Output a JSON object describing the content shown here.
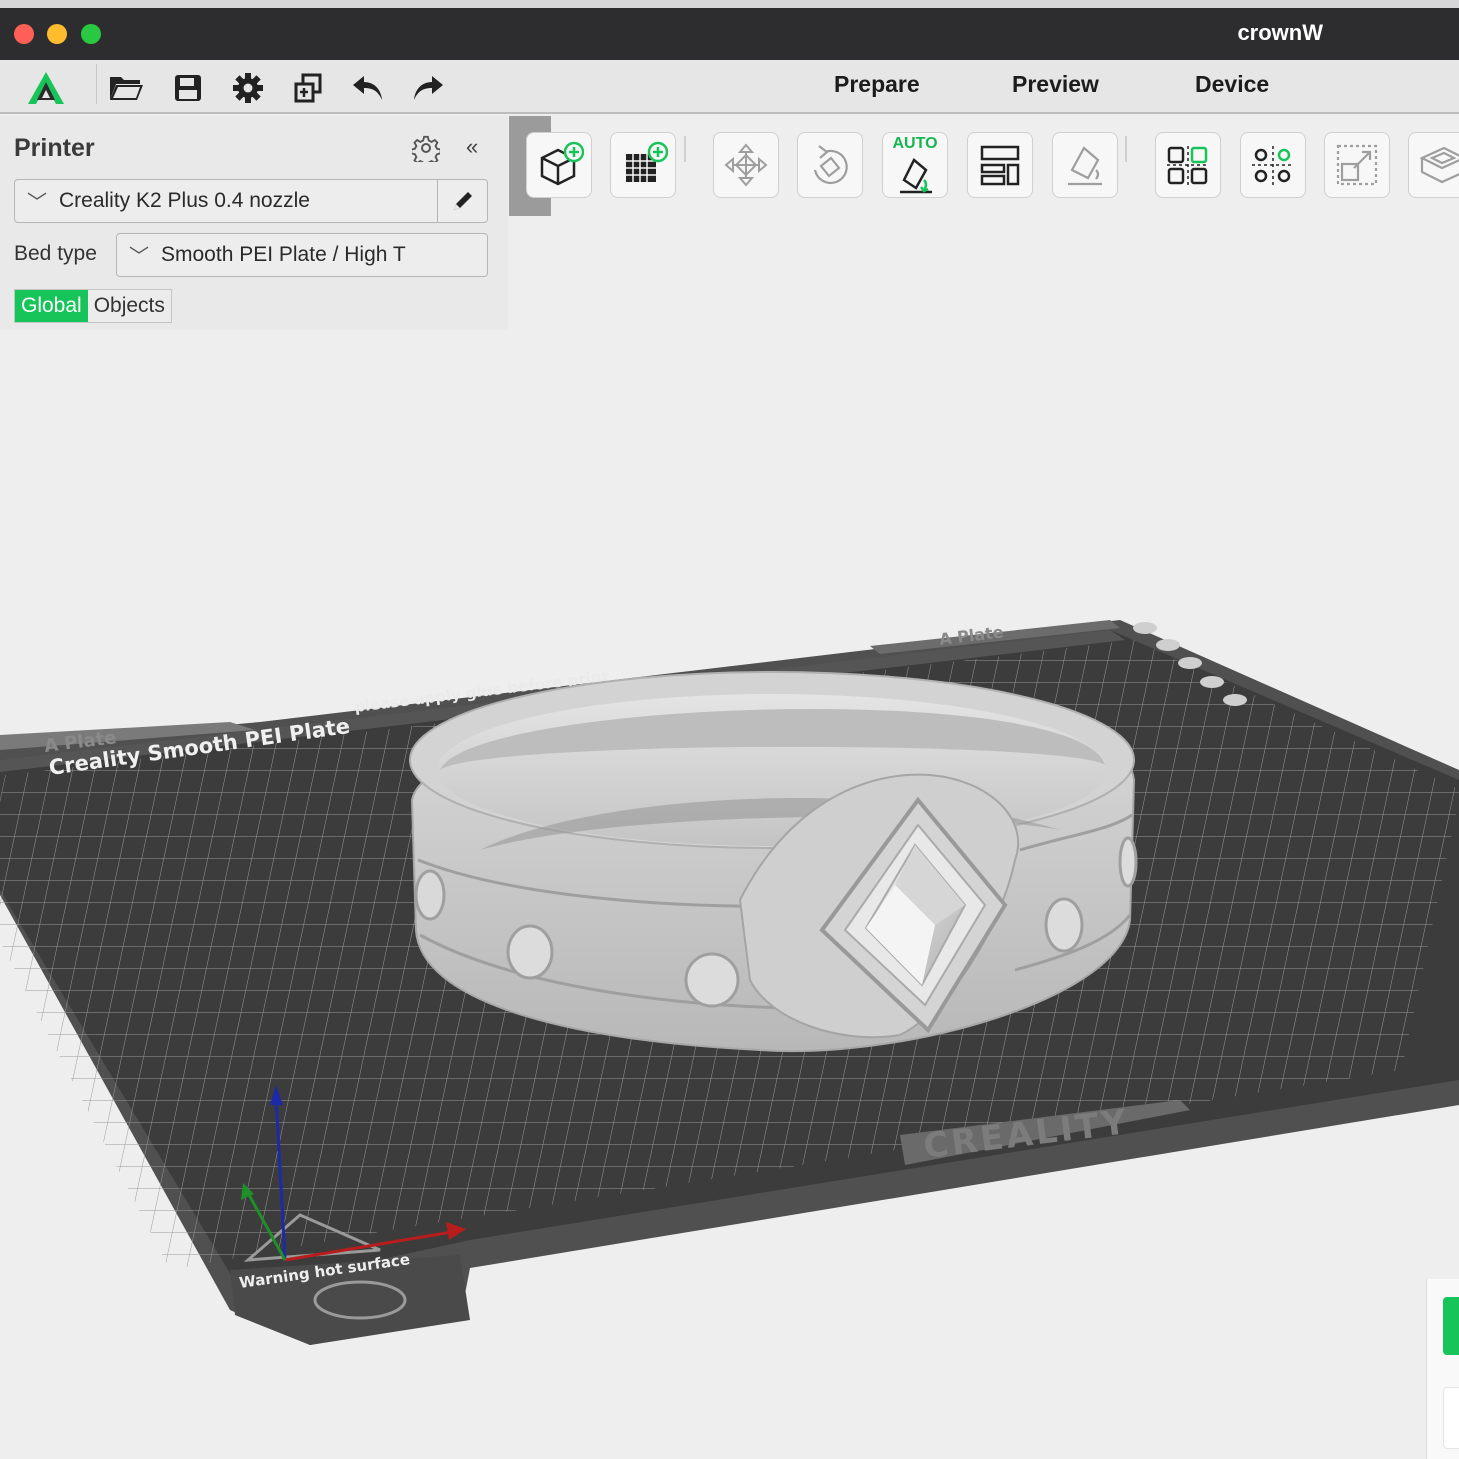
{
  "window": {
    "title": "crownW"
  },
  "toolbar": {
    "icons": [
      "app-logo-icon",
      "open-folder-icon",
      "save-icon",
      "settings-gear-icon",
      "copy-icon",
      "undo-icon",
      "redo-icon"
    ],
    "tabs": {
      "prepare": "Prepare",
      "preview": "Preview",
      "device": "Device"
    }
  },
  "panel": {
    "title": "Printer",
    "printer_value": "Creality K2 Plus 0.4 nozzle",
    "bed_type_label": "Bed type",
    "bed_type_value": "Smooth PEI Plate / High T",
    "collapse_glyph": "«",
    "chevron_glyph": "﹀",
    "segments": {
      "global": "Global",
      "objects": "Objects"
    }
  },
  "canvas_toolbar": {
    "handle_glyph": "‹",
    "auto_label": "AUTO",
    "tools": [
      "add-object-icon",
      "add-plate-icon",
      "move-icon",
      "rotate-icon",
      "auto-orient-icon",
      "arrange-icon",
      "lay-on-face-icon",
      "split-objects-icon",
      "split-parts-icon",
      "scale-icon",
      "slice-view-icon"
    ]
  },
  "bed": {
    "print_1": "Creality Smooth PEI Plate",
    "print_2": "please apply glue before print",
    "print_3": "A Plate",
    "print_4": "A Plate",
    "brand": "CREALITY",
    "warning": "Warning hot surface"
  },
  "colors": {
    "accent_green": "#17c45a",
    "titlebar": "#2d2d2f",
    "bed": "#4a4a4a",
    "model": "#c9c9c9"
  }
}
